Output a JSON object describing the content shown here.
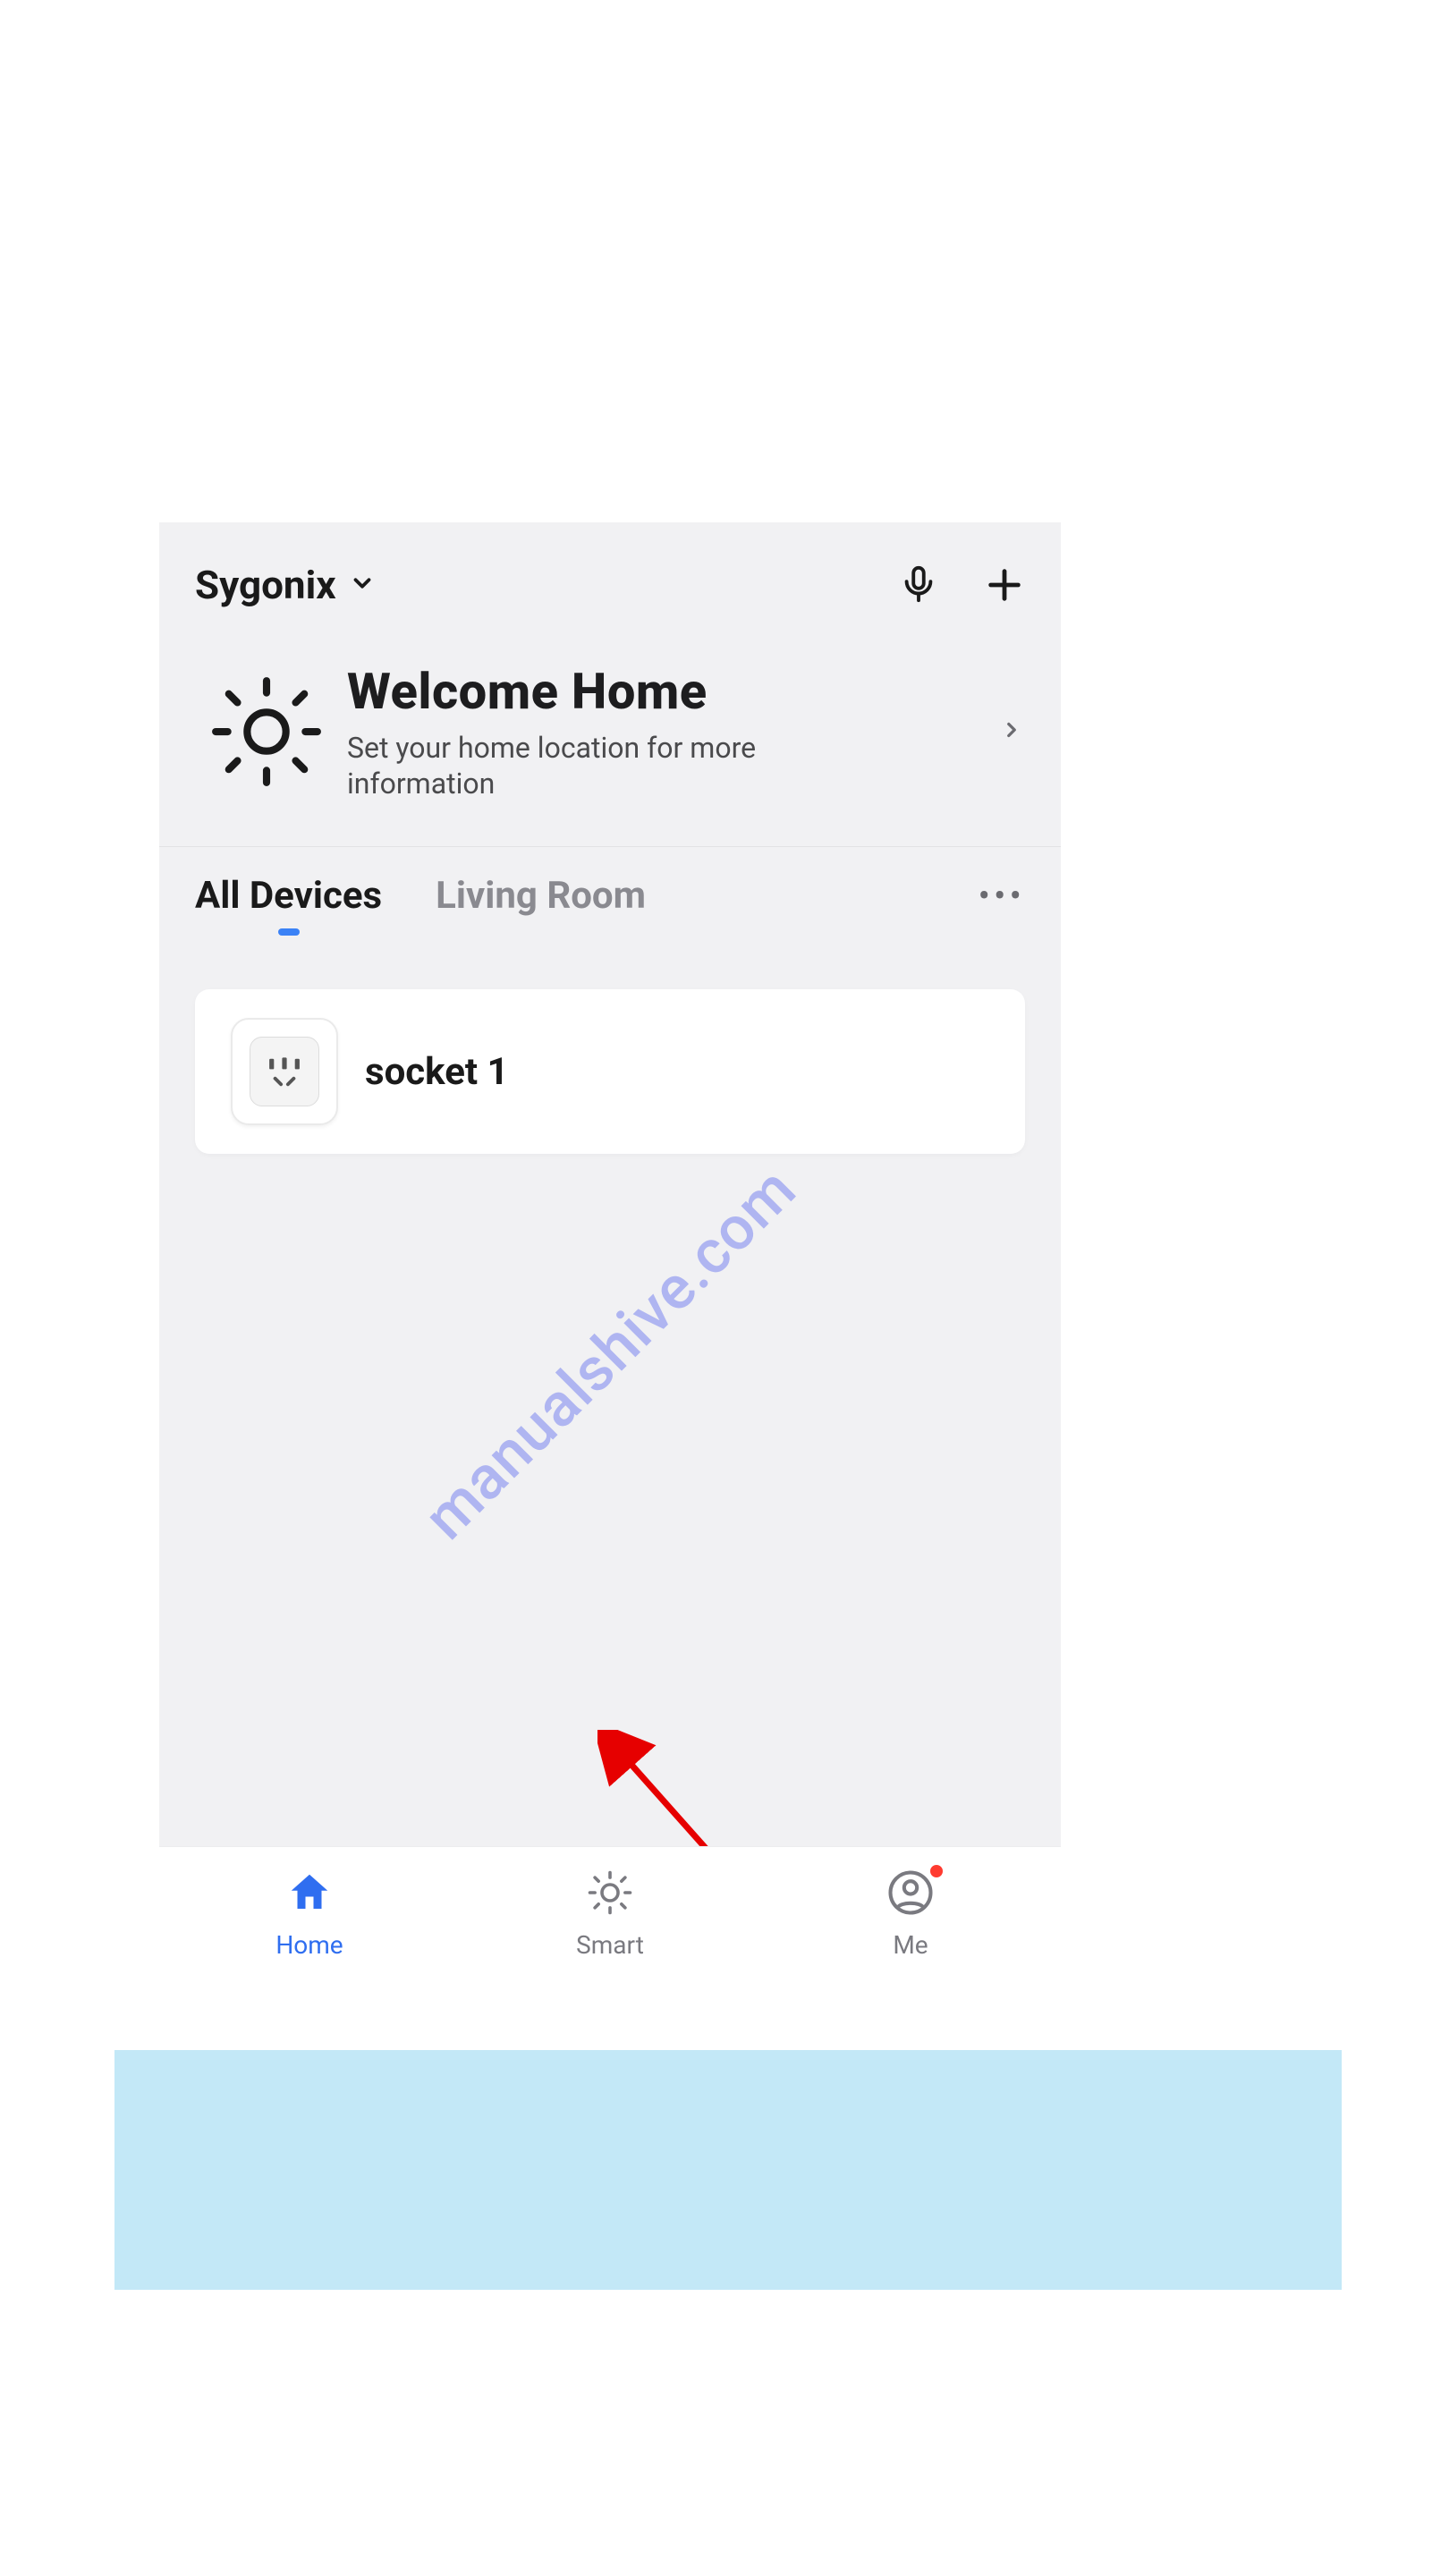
{
  "header": {
    "home_name": "Sygonix"
  },
  "welcome": {
    "title": "Welcome Home",
    "subtitle": "Set your home location for more information"
  },
  "tabs": {
    "all_devices": "All Devices",
    "living_room": "Living Room"
  },
  "device": {
    "name": "socket 1"
  },
  "watermark_text": "manualshive.com",
  "nav": {
    "home": "Home",
    "smart": "Smart",
    "me": "Me"
  }
}
